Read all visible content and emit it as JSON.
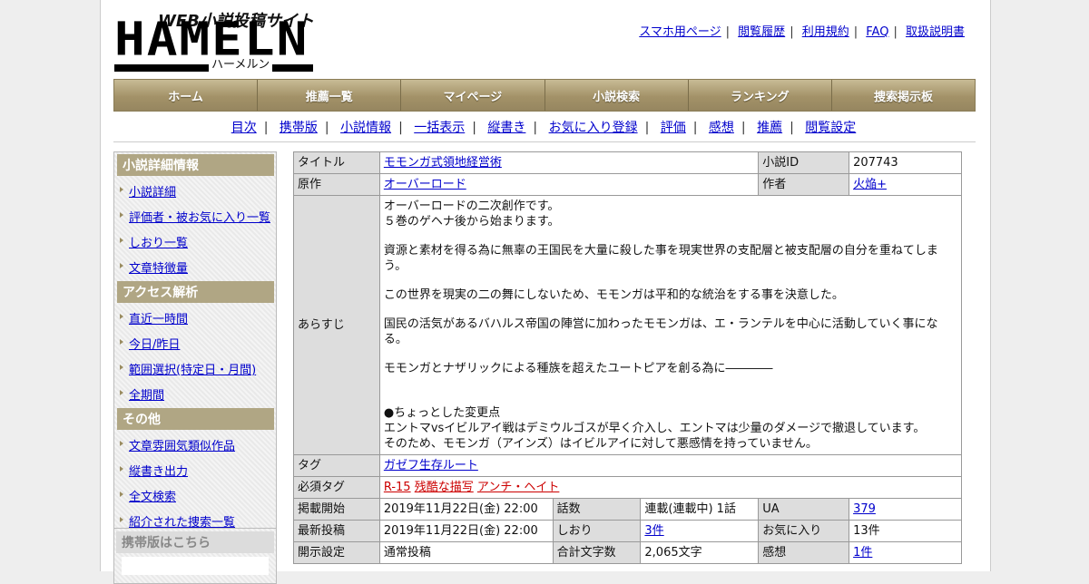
{
  "logo": {
    "tagline": "WEB小説投稿サイト",
    "name": "HAMELN",
    "kana": "ハーメルン"
  },
  "top_links": [
    "スマホ用ページ",
    "閲覧履歴",
    "利用規約",
    "FAQ",
    "取扱説明書"
  ],
  "main_nav": [
    "ホーム",
    "推薦一覧",
    "マイページ",
    "小説検索",
    "ランキング",
    "捜索掲示板"
  ],
  "sub_nav": [
    "目次",
    "携帯版",
    "小説情報",
    "一括表示",
    "縦書き",
    "お気に入り登録",
    "評価",
    "感想",
    "推薦",
    "閲覧設定"
  ],
  "sidebar": {
    "detail_heading": "小説詳細情報",
    "detail_items": [
      "小説詳細",
      "評価者・被お気に入り一覧",
      "しおり一覧",
      "文章特徴量"
    ],
    "access_heading": "アクセス解析",
    "access_items": [
      "直近一時間",
      "今日/昨日",
      "範囲選択(特定日・月間)",
      "全期間"
    ],
    "other_heading": "その他",
    "other_items": [
      "文章雰囲気類似作品",
      "縦書き出力",
      "全文検索",
      "紹介された捜索一覧"
    ],
    "mobile_heading": "携帯版はこちら"
  },
  "info": {
    "title_label": "タイトル",
    "title": "モモンガ式領地経営術",
    "novel_id_label": "小説ID",
    "novel_id": "207743",
    "original_label": "原作",
    "original": "オーバーロード",
    "author_label": "作者",
    "author": "火焔+",
    "synopsis_label": "あらすじ",
    "synopsis": [
      "オーバーロードの二次創作です。",
      "５巻のゲヘナ後から始まります。",
      "資源と素材を得る為に無辜の王国民を大量に殺した事を現実世界の支配層と被支配層の自分を重ねてしまう。",
      "この世界を現実の二の舞にしないため、モモンガは平和的な統治をする事を決意した。",
      "国民の活気があるバハルス帝国の陣営に加わったモモンガは、エ・ランテルを中心に活動していく事になる。",
      "モモンガとナザリックによる種族を超えたユートピアを創る為に――――",
      "●ちょっとした変更点",
      "エントマvsイビルアイ戦はデミウルゴスが早く介入し、エントマは少量のダメージで撤退しています。",
      "そのため、モモンガ（アインズ）はイビルアイに対して悪感情を持っていません。"
    ],
    "tag_label": "タグ",
    "tags": [
      "ガゼフ生存ルート"
    ],
    "required_tag_label": "必須タグ",
    "required_tags": [
      "R-15",
      "残酷な描写",
      "アンチ・ヘイト"
    ],
    "published_label": "掲載開始",
    "published": "2019年11月22日(金) 22:00",
    "episodes_label": "話数",
    "episodes": "連載(連載中) 1話",
    "ua_label": "UA",
    "ua": "379",
    "latest_label": "最新投稿",
    "latest": "2019年11月22日(金) 22:00",
    "bookmarks_label": "しおり",
    "bookmarks": "3件",
    "favorites_label": "お気に入り",
    "favorites": "13件",
    "disclosure_label": "開示設定",
    "disclosure": "通常投稿",
    "chars_label": "合計文字数",
    "chars": "2,065文字",
    "reviews_label": "感想",
    "reviews": "1件"
  }
}
